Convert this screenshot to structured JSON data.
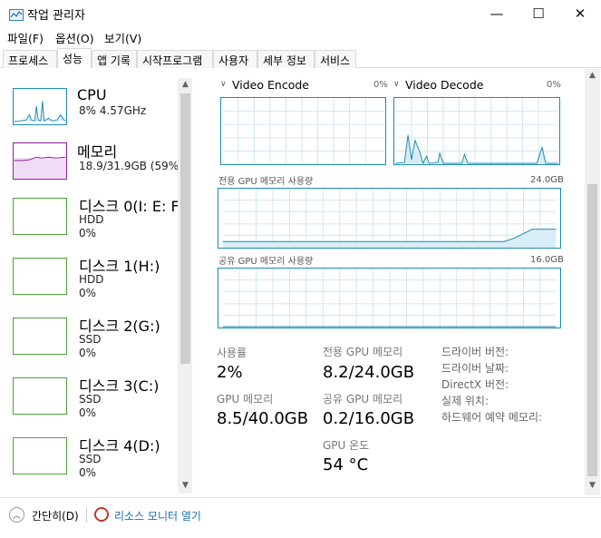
{
  "window": {
    "title": "작업 관리자",
    "minimize_glyph": "—",
    "maximize_glyph": "☐",
    "close_glyph": "✕"
  },
  "menu": [
    "파일(F)",
    "옵션(O)",
    "보기(V)"
  ],
  "tabs": [
    {
      "label": "프로세스",
      "active": false
    },
    {
      "label": "성능",
      "active": true
    },
    {
      "label": "앱 기록",
      "active": false
    },
    {
      "label": "시작프로그램",
      "active": false
    },
    {
      "label": "사용자",
      "active": false
    },
    {
      "label": "세부 정보",
      "active": false
    },
    {
      "label": "서비스",
      "active": false
    }
  ],
  "sidebar": {
    "items": [
      {
        "title": "CPU",
        "line1": "8% 4.57GHz",
        "line2": "",
        "color": "#1a8bb5"
      },
      {
        "title": "메모리",
        "line1": "18.9/31.9GB (59%)",
        "line2": "",
        "color": "#8b1fa0"
      },
      {
        "title": "디스크 0(I: E: F:",
        "line1": "HDD",
        "line2": "0%",
        "color": "#4da33b"
      },
      {
        "title": "디스크 1(H:)",
        "line1": "HDD",
        "line2": "0%",
        "color": "#4da33b"
      },
      {
        "title": "디스크 2(G:)",
        "line1": "SSD",
        "line2": "0%",
        "color": "#4da33b"
      },
      {
        "title": "디스크 3(C:)",
        "line1": "SSD",
        "line2": "0%",
        "color": "#4da33b"
      },
      {
        "title": "디스크 4(D:)",
        "line1": "SSD",
        "line2": "0%",
        "color": "#4da33b"
      }
    ]
  },
  "gpu": {
    "engines": [
      {
        "label": "Video Encode",
        "percent": "0%"
      },
      {
        "label": "Video Decode",
        "percent": "0%"
      }
    ],
    "dedicated_caption": "전용 GPU 메모리 사용량",
    "dedicated_max": "24.0GB",
    "shared_caption": "공유 GPU 메모리 사용량",
    "shared_max": "16.0GB",
    "stats": {
      "usage_label": "사용률",
      "usage_value": "2%",
      "gpu_mem_label": "GPU 메모리",
      "gpu_mem_value": "8.5/40.0GB",
      "dedicated_label": "전용 GPU 메모리",
      "dedicated_value": "8.2/24.0GB",
      "shared_label": "공유 GPU 메모리",
      "shared_value": "0.2/16.0GB",
      "temp_label": "GPU 온도",
      "temp_value": "54 °C"
    },
    "info_labels": [
      "드라이버 버전:",
      "드라이버 날짜:",
      "DirectX 버전:",
      "실제 위치:",
      "하드웨어 예약 메모리:"
    ],
    "accent": "#1a8bb5"
  },
  "footer": {
    "collapse_label": "간단히(D)",
    "resource_monitor_label": "리소스 모니터 열기"
  }
}
